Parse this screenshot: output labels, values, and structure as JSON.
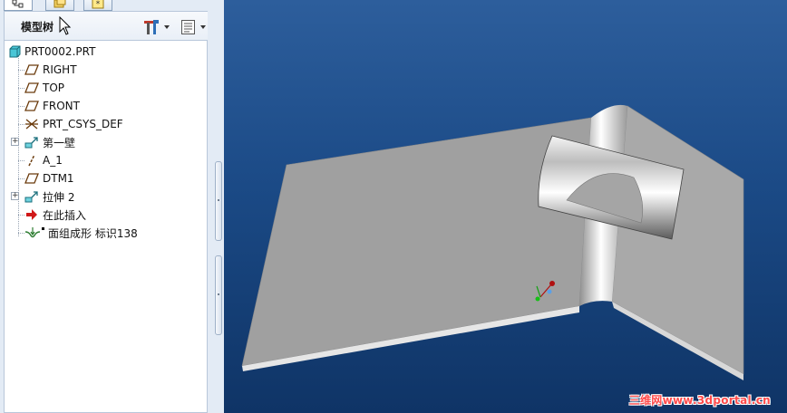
{
  "navigator": {
    "title": "模型树",
    "tabs": [
      {
        "name": "model-tree-tab",
        "icon": "tree-icon"
      },
      {
        "name": "folder-browser-tab",
        "icon": "folder-icon"
      },
      {
        "name": "favorites-tab",
        "icon": "star-icon"
      }
    ],
    "toolbar": {
      "settings_icon": "tools-icon",
      "show_icon": "list-icon"
    }
  },
  "tree": {
    "items": [
      {
        "label": "PRT0002.PRT",
        "icon": "part-icon",
        "expander": ""
      },
      {
        "label": "RIGHT",
        "icon": "datum-plane-icon",
        "expander": ""
      },
      {
        "label": "TOP",
        "icon": "datum-plane-icon",
        "expander": ""
      },
      {
        "label": "FRONT",
        "icon": "datum-plane-icon",
        "expander": ""
      },
      {
        "label": "PRT_CSYS_DEF",
        "icon": "csys-icon",
        "expander": ""
      },
      {
        "label": "第一壁",
        "icon": "sheetmetal-wall-icon",
        "expander": "+"
      },
      {
        "label": "A_1",
        "icon": "datum-axis-icon",
        "expander": ""
      },
      {
        "label": "DTM1",
        "icon": "datum-plane-icon",
        "expander": ""
      },
      {
        "label": "拉伸 2",
        "icon": "extrude-icon",
        "expander": "+"
      },
      {
        "label": "在此插入",
        "icon": "insert-here-icon",
        "expander": ""
      },
      {
        "label": "面组成形 标识138",
        "icon": "form-feature-icon",
        "expander": ""
      }
    ]
  },
  "viewport": {
    "watermark": "三维网www.3dportal.cn",
    "colors": {
      "background_top": "#2d5e9c",
      "background_bottom": "#0f3466",
      "part_face": "#a3a3a3"
    }
  }
}
